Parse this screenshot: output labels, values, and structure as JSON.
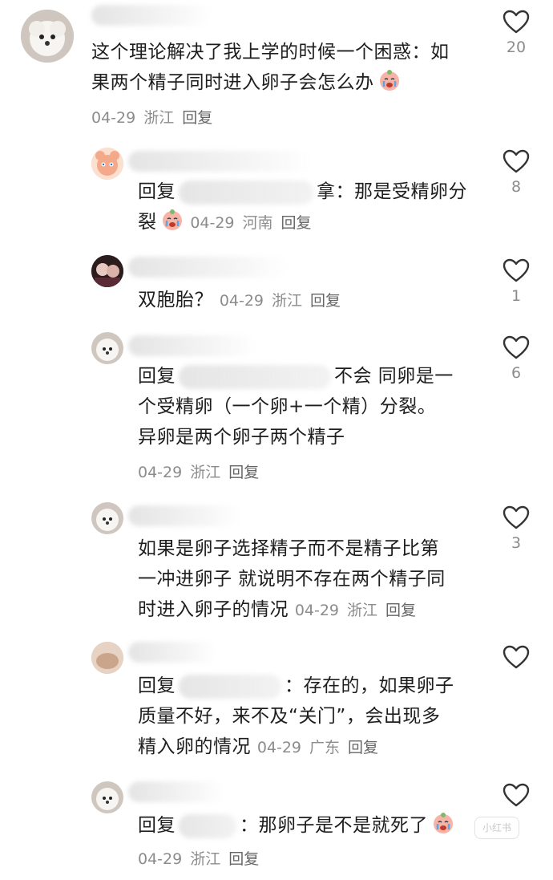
{
  "comments": [
    {
      "name": "",
      "text_lines": [
        "这个理论解决了我上学的时候一个困惑：如",
        "果两个精子同时进入卵子会怎么办"
      ],
      "date": "04-29",
      "location": "浙江",
      "reply_label": "回复",
      "likes": "20"
    },
    {
      "reply_prefix": "回复",
      "text_tail": "拿：那是受精卵分",
      "text_line2": "裂",
      "date": "04-29",
      "location": "河南",
      "reply_label": "回复",
      "likes": "8"
    },
    {
      "text": "双胞胎？",
      "date": "04-29",
      "location": "浙江",
      "reply_label": "回复",
      "likes": "1"
    },
    {
      "reply_prefix": "回复",
      "text_tail": "不会 同卵是一",
      "text_lines": [
        "个受精卵（一个卵+一个精）分裂。",
        "异卵是两个卵子两个精子"
      ],
      "date": "04-29",
      "location": "浙江",
      "reply_label": "回复",
      "likes": "6"
    },
    {
      "text_lines": [
        "如果是卵子选择精子而不是精子比第",
        "一冲进卵子 就说明不存在两个精子同",
        "时进入卵子的情况"
      ],
      "date": "04-29",
      "location": "浙江",
      "reply_label": "回复",
      "likes": "3"
    },
    {
      "reply_prefix": "回复",
      "text_tail": "：存在的，如果卵子",
      "text_lines": [
        "质量不好，来不及“关门”，会出现多",
        "精入卵的情况"
      ],
      "date": "04-29",
      "location": "广东",
      "reply_label": "回复",
      "likes": ""
    },
    {
      "reply_prefix": "回复",
      "text_tail": "：那卵子是不是就死了",
      "date": "04-29",
      "location": "浙江",
      "reply_label": "回复",
      "likes": ""
    }
  ],
  "watermark": "小红书",
  "icons": {
    "like": "heart-outline-icon",
    "emoji": "crying-face-emoji"
  },
  "colors": {
    "meta": "#8c8c8c",
    "text": "#1e1e1e",
    "icon": "#333333"
  }
}
